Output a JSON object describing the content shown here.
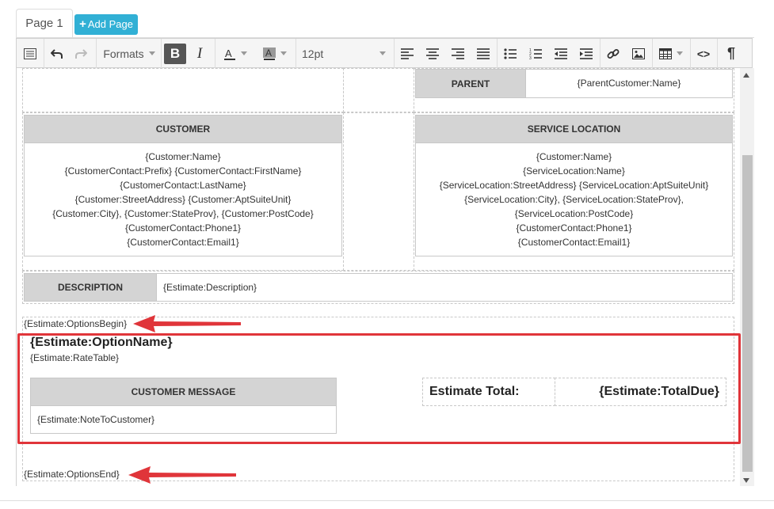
{
  "tabs": {
    "page_label": "Page 1",
    "add_label": "Add Page"
  },
  "toolbar": {
    "formats_label": "Formats",
    "bold_label": "B",
    "italic_label": "I",
    "fontsize_label": "12pt",
    "pilcrow_label": "¶",
    "code_label": "<>",
    "icons": [
      "source-icon",
      "undo-icon",
      "redo-icon",
      "bold-icon",
      "italic-icon",
      "text-color-icon",
      "bg-color-icon",
      "align-left-icon",
      "align-center-icon",
      "align-right-icon",
      "justify-icon",
      "bullet-list-icon",
      "numbered-list-icon",
      "outdent-icon",
      "indent-icon",
      "link-icon",
      "image-icon",
      "table-icon",
      "code-icon",
      "pilcrow-icon"
    ]
  },
  "template": {
    "parent": {
      "header": "PARENT",
      "value": "{ParentCustomer:Name}"
    },
    "customer": {
      "header": "CUSTOMER",
      "lines": [
        "{Customer:Name}",
        "{CustomerContact:Prefix} {CustomerContact:FirstName}",
        "{CustomerContact:LastName}",
        "{Customer:StreetAddress} {Customer:AptSuiteUnit}",
        "{Customer:City}, {Customer:StateProv}, {Customer:PostCode}",
        "{CustomerContact:Phone1}",
        "{CustomerContact:Email1}"
      ]
    },
    "service_location": {
      "header": "SERVICE LOCATION",
      "lines": [
        "{Customer:Name}",
        "{ServiceLocation:Name}",
        "{ServiceLocation:StreetAddress} {ServiceLocation:AptSuiteUnit}",
        "{ServiceLocation:City}, {ServiceLocation:StateProv},",
        "{ServiceLocation:PostCode}",
        "{CustomerContact:Phone1}",
        "{CustomerContact:Email1}"
      ]
    },
    "description": {
      "header": "DESCRIPTION",
      "value": "{Estimate:Description}"
    },
    "options_begin": "{Estimate:OptionsBegin}",
    "option_name": "{Estimate:OptionName}",
    "rate_table": "{Estimate:RateTable}",
    "customer_message": {
      "header": "CUSTOMER MESSAGE",
      "value": "{Estimate:NoteToCustomer}"
    },
    "estimate_total": {
      "label": "Estimate Total:",
      "value": "{Estimate:TotalDue}"
    },
    "options_end": "{Estimate:OptionsEnd}"
  },
  "colors": {
    "highlight": "#e0353a",
    "add_button": "#31b0d5",
    "header_bg": "#d4d4d4"
  }
}
